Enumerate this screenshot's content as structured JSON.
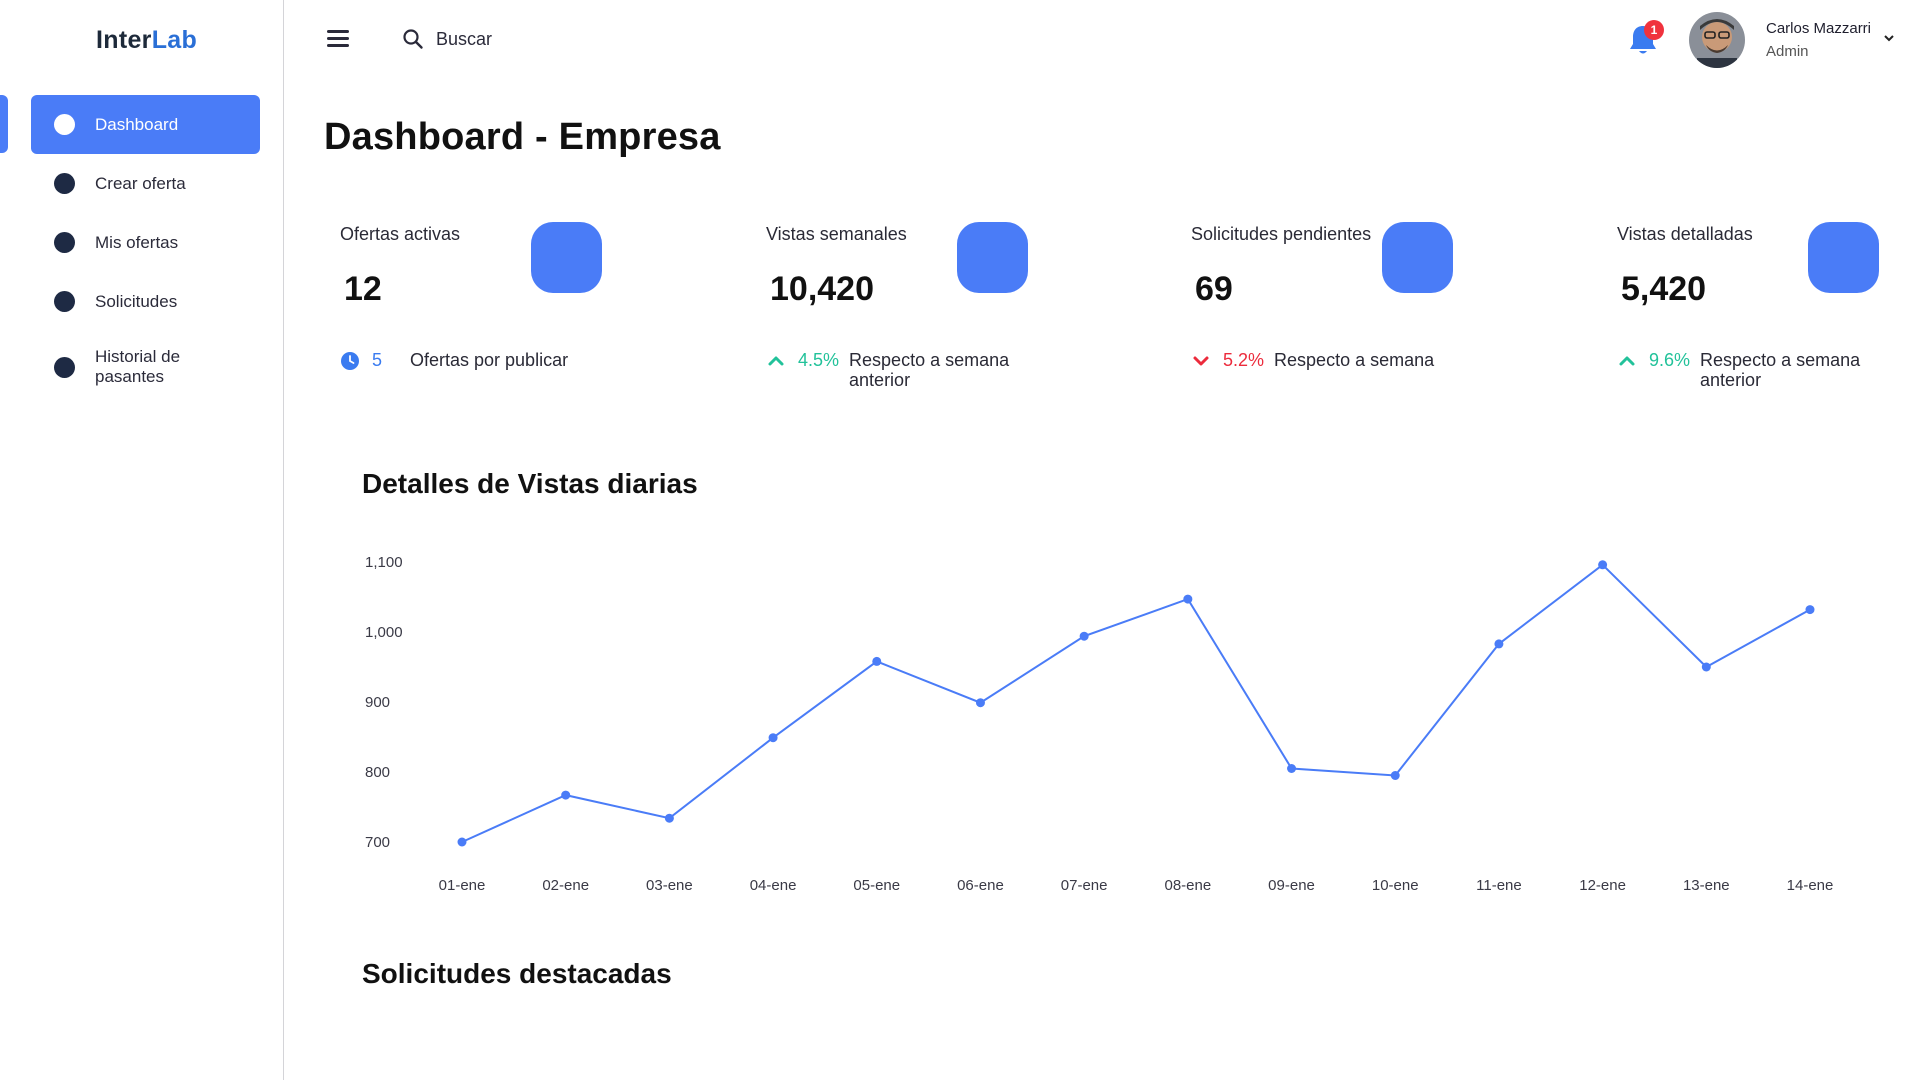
{
  "app": {
    "logo_part1": "Inter",
    "logo_part2": "Lab"
  },
  "sidebar": {
    "items": [
      {
        "label": "Dashboard",
        "active": true
      },
      {
        "label": "Crear oferta",
        "active": false
      },
      {
        "label": "Mis ofertas",
        "active": false
      },
      {
        "label": "Solicitudes",
        "active": false
      },
      {
        "label": "Historial de pasantes",
        "active": false
      }
    ]
  },
  "header": {
    "search_placeholder": "Buscar",
    "notifications_count": "1",
    "user_name": "Carlos Mazzarri",
    "user_role": "Admin",
    "icons": [
      "menu-icon",
      "search-icon",
      "bell-icon",
      "chevron-down-icon"
    ]
  },
  "page": {
    "title": "Dashboard - Empresa"
  },
  "stats": [
    {
      "label": "Ofertas activas",
      "value": "12",
      "foot_icon": "clock-icon",
      "foot_value": "5",
      "foot_text": "Ofertas por publicar",
      "trend": "neutral"
    },
    {
      "label": "Vistas semanales",
      "value": "10,420",
      "foot_icon": "chevron-up-icon",
      "foot_value": "4.5%",
      "foot_text": "Respecto a semana anterior",
      "trend": "up"
    },
    {
      "label": "Solicitudes pendientes",
      "value": "69",
      "foot_icon": "chevron-down-icon",
      "foot_value": "5.2%",
      "foot_text": "Respecto a semana",
      "trend": "down"
    },
    {
      "label": "Vistas detalladas",
      "value": "5,420",
      "foot_icon": "chevron-up-icon",
      "foot_value": "9.6%",
      "foot_text": "Respecto a semana anterior",
      "trend": "up"
    }
  ],
  "colors": {
    "accent": "#4a7cf7",
    "up": "#22c29a",
    "down": "#ec2b3c",
    "info": "#3a7bf0",
    "badge": "#f0323d"
  },
  "sections": {
    "chart_title": "Detalles de Vistas diarias",
    "featured_title": "Solicitudes destacadas"
  },
  "chart_data": {
    "type": "line",
    "title": "Detalles de Vistas diarias",
    "xlabel": "",
    "ylabel": "",
    "categories": [
      "01-ene",
      "02-ene",
      "03-ene",
      "04-ene",
      "05-ene",
      "06-ene",
      "07-ene",
      "08-ene",
      "09-ene",
      "10-ene",
      "11-ene",
      "12-ene",
      "13-ene",
      "14-ene"
    ],
    "series": [
      {
        "values": [
          700,
          767,
          734,
          849,
          958,
          899,
          994,
          1047,
          805,
          795,
          983,
          1096,
          950,
          1032
        ]
      }
    ],
    "yticks": [
      "700",
      "800",
      "900",
      "1,000",
      "1,100"
    ],
    "ylim": [
      700,
      1100
    ],
    "grid": false,
    "legend": "none",
    "color": "#4a7cf7"
  }
}
